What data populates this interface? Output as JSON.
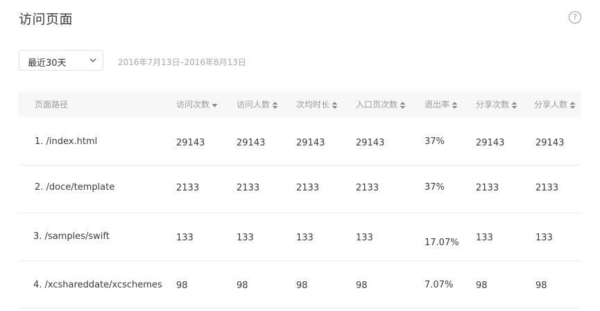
{
  "page": {
    "title": "访问页面",
    "help_icon": "?"
  },
  "filter": {
    "range_label": "最近30天",
    "date_range": "2016年7月13日–2016年8月13日"
  },
  "table": {
    "columns": [
      {
        "key": "path",
        "label": "页面路径",
        "sort": "none"
      },
      {
        "key": "visits",
        "label": "访问次数",
        "sort": "desc"
      },
      {
        "key": "visitors",
        "label": "访问人数",
        "sort": "both"
      },
      {
        "key": "avg_duration",
        "label": "次均时长",
        "sort": "both"
      },
      {
        "key": "entry_count",
        "label": "入口页次数",
        "sort": "both"
      },
      {
        "key": "exit_rate",
        "label": "退出率",
        "sort": "both"
      },
      {
        "key": "shares",
        "label": "分享次数",
        "sort": "both"
      },
      {
        "key": "sharers",
        "label": "分享人数",
        "sort": "both"
      }
    ],
    "rows": [
      {
        "path": "1. /index.html",
        "visits": "29143",
        "visitors": "29143",
        "avg_duration": "29143",
        "entry_count": "29143",
        "exit_rate": "37%",
        "shares": "29143",
        "sharers": "29143"
      },
      {
        "path": "2. /doce/template",
        "visits": "2133",
        "visitors": "2133",
        "avg_duration": "2133",
        "entry_count": "2133",
        "exit_rate": "37%",
        "shares": "2133",
        "sharers": "2133"
      },
      {
        "path": "3. /samples/swift",
        "visits": "133",
        "visitors": "133",
        "avg_duration": "133",
        "entry_count": "133",
        "exit_rate": "17.07%",
        "shares": "133",
        "sharers": "133"
      },
      {
        "path": "4. /xcshareddate/xcschemes",
        "visits": "98",
        "visitors": "98",
        "avg_duration": "98",
        "entry_count": "98",
        "exit_rate": "7.07%",
        "shares": "98",
        "sharers": "98"
      }
    ]
  }
}
